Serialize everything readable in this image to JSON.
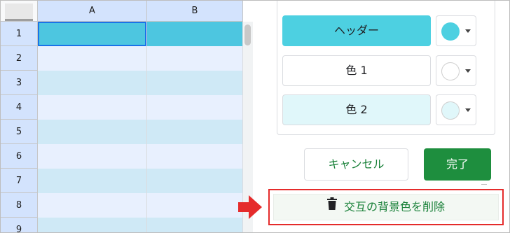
{
  "sheet": {
    "columns": [
      "A",
      "B"
    ],
    "rows": [
      "1",
      "2",
      "3",
      "4",
      "5",
      "6",
      "7",
      "8",
      "9"
    ],
    "colors": {
      "header": "#4dc6e0",
      "color1": "#e8f0fe",
      "color2": "#cfe9f6"
    }
  },
  "panel": {
    "styles": [
      {
        "label": "ヘッダー",
        "fill": "#4dd0e1",
        "text_color": "#202124",
        "swatch": "#4dd0e1"
      },
      {
        "label": "色 1",
        "fill": "#ffffff",
        "text_color": "#202124",
        "swatch": "#ffffff"
      },
      {
        "label": "色 2",
        "fill": "#e0f7fa",
        "text_color": "#202124",
        "swatch": "#e0f7fa"
      }
    ],
    "cancel_label": "キャンセル",
    "done_label": "完了",
    "remove_label": "交互の背景色を削除"
  }
}
